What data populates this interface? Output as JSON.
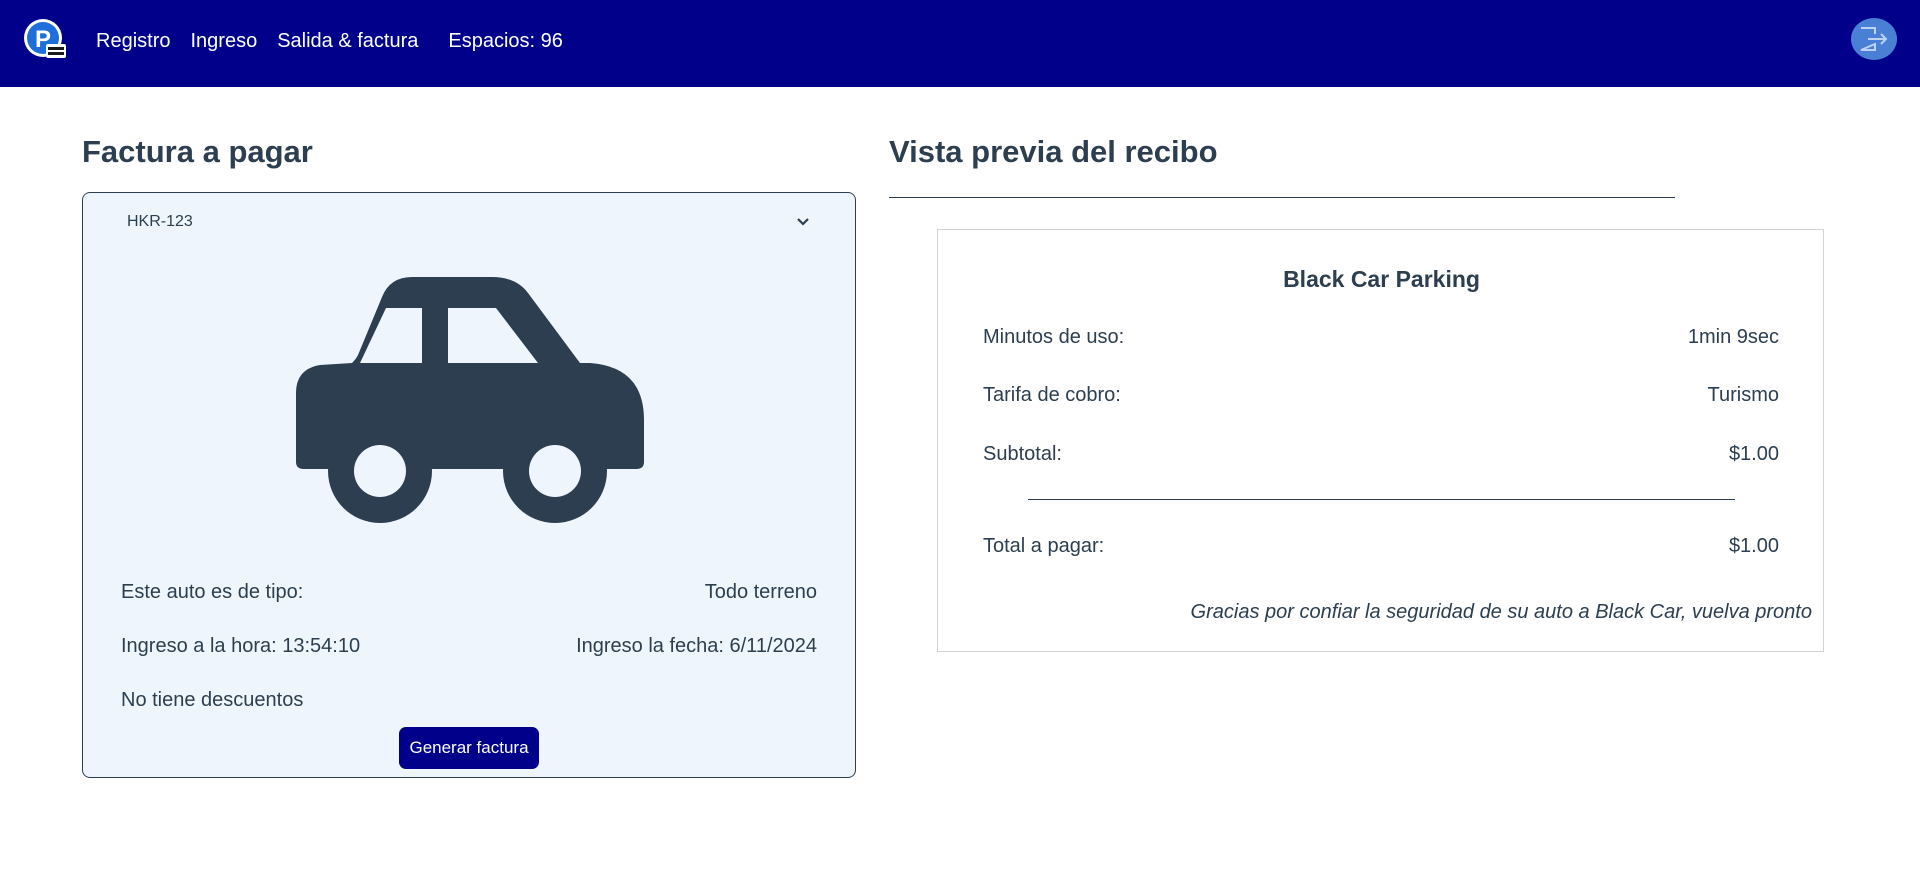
{
  "navbar": {
    "logo_icon": "parking-logo-icon",
    "links": [
      {
        "label": "Registro"
      },
      {
        "label": "Ingreso"
      },
      {
        "label": "Salida & factura"
      }
    ],
    "spaces_label": "Espacios: 96",
    "logout_icon": "logout-icon",
    "background_color": "#00008b"
  },
  "invoice": {
    "title": "Factura a pagar",
    "plate_selected": "HKR-123",
    "vehicle_icon": "car-icon",
    "type_label": "Este auto es de tipo:",
    "type_value": "Todo terreno",
    "entry_time": "Ingreso a la hora: 13:54:10",
    "entry_date": "Ingreso la fecha: 6/11/2024",
    "discount": "No tiene descuentos",
    "generate_button": "Generar factura"
  },
  "receipt": {
    "title": "Vista previa del recibo",
    "business_name": "Black Car Parking",
    "rows": [
      {
        "label": "Minutos de uso:",
        "value": "1min 9sec"
      },
      {
        "label": "Tarifa de cobro:",
        "value": "Turismo"
      },
      {
        "label": "Subtotal:",
        "value": "$1.00"
      }
    ],
    "total_label": "Total a pagar:",
    "total_value": "$1.00",
    "thanks": "Gracias por confiar la seguridad de su auto a Black Car, vuelva pronto"
  }
}
